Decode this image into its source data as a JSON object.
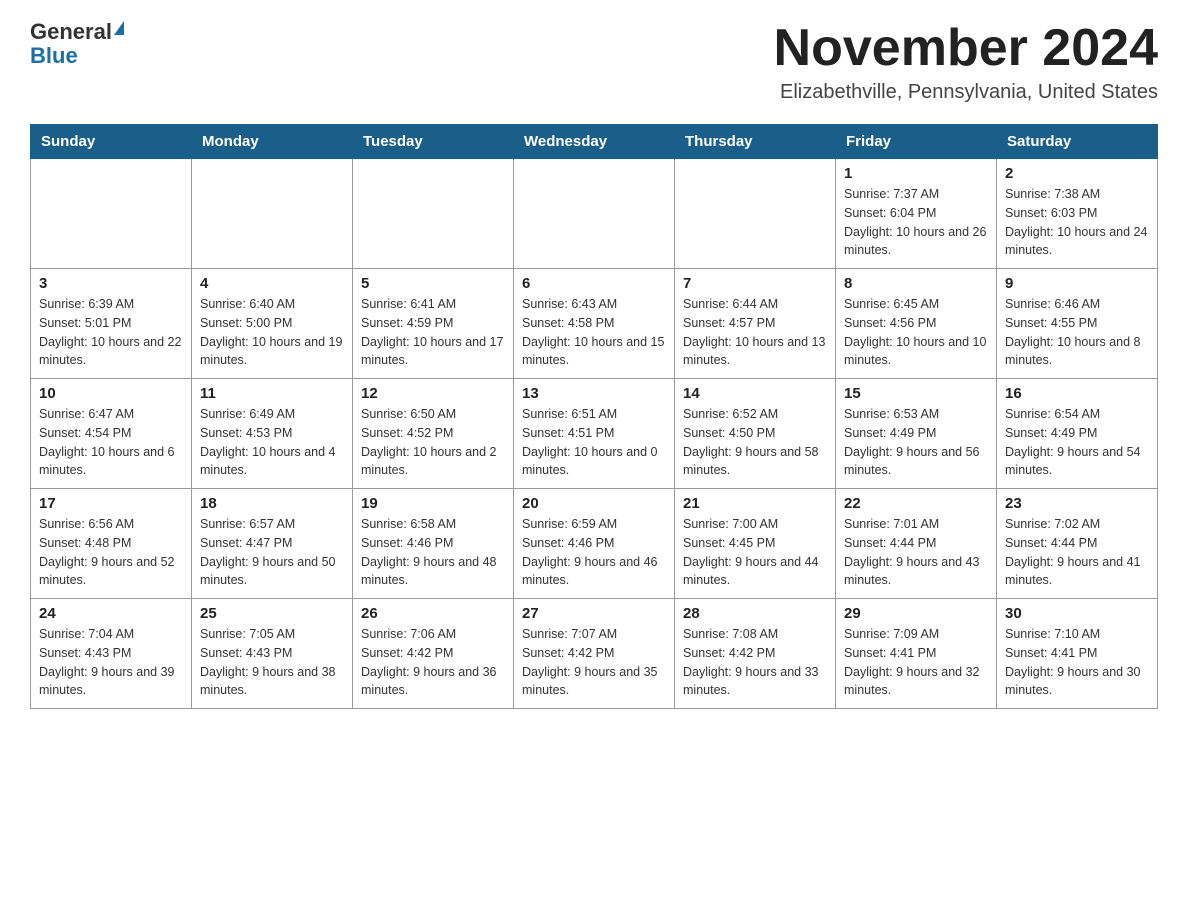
{
  "header": {
    "logo_line1": "General",
    "logo_line2": "Blue",
    "month": "November 2024",
    "location": "Elizabethville, Pennsylvania, United States"
  },
  "weekdays": [
    "Sunday",
    "Monday",
    "Tuesday",
    "Wednesday",
    "Thursday",
    "Friday",
    "Saturday"
  ],
  "weeks": [
    [
      {
        "day": "",
        "info": ""
      },
      {
        "day": "",
        "info": ""
      },
      {
        "day": "",
        "info": ""
      },
      {
        "day": "",
        "info": ""
      },
      {
        "day": "",
        "info": ""
      },
      {
        "day": "1",
        "info": "Sunrise: 7:37 AM\nSunset: 6:04 PM\nDaylight: 10 hours and 26 minutes."
      },
      {
        "day": "2",
        "info": "Sunrise: 7:38 AM\nSunset: 6:03 PM\nDaylight: 10 hours and 24 minutes."
      }
    ],
    [
      {
        "day": "3",
        "info": "Sunrise: 6:39 AM\nSunset: 5:01 PM\nDaylight: 10 hours and 22 minutes."
      },
      {
        "day": "4",
        "info": "Sunrise: 6:40 AM\nSunset: 5:00 PM\nDaylight: 10 hours and 19 minutes."
      },
      {
        "day": "5",
        "info": "Sunrise: 6:41 AM\nSunset: 4:59 PM\nDaylight: 10 hours and 17 minutes."
      },
      {
        "day": "6",
        "info": "Sunrise: 6:43 AM\nSunset: 4:58 PM\nDaylight: 10 hours and 15 minutes."
      },
      {
        "day": "7",
        "info": "Sunrise: 6:44 AM\nSunset: 4:57 PM\nDaylight: 10 hours and 13 minutes."
      },
      {
        "day": "8",
        "info": "Sunrise: 6:45 AM\nSunset: 4:56 PM\nDaylight: 10 hours and 10 minutes."
      },
      {
        "day": "9",
        "info": "Sunrise: 6:46 AM\nSunset: 4:55 PM\nDaylight: 10 hours and 8 minutes."
      }
    ],
    [
      {
        "day": "10",
        "info": "Sunrise: 6:47 AM\nSunset: 4:54 PM\nDaylight: 10 hours and 6 minutes."
      },
      {
        "day": "11",
        "info": "Sunrise: 6:49 AM\nSunset: 4:53 PM\nDaylight: 10 hours and 4 minutes."
      },
      {
        "day": "12",
        "info": "Sunrise: 6:50 AM\nSunset: 4:52 PM\nDaylight: 10 hours and 2 minutes."
      },
      {
        "day": "13",
        "info": "Sunrise: 6:51 AM\nSunset: 4:51 PM\nDaylight: 10 hours and 0 minutes."
      },
      {
        "day": "14",
        "info": "Sunrise: 6:52 AM\nSunset: 4:50 PM\nDaylight: 9 hours and 58 minutes."
      },
      {
        "day": "15",
        "info": "Sunrise: 6:53 AM\nSunset: 4:49 PM\nDaylight: 9 hours and 56 minutes."
      },
      {
        "day": "16",
        "info": "Sunrise: 6:54 AM\nSunset: 4:49 PM\nDaylight: 9 hours and 54 minutes."
      }
    ],
    [
      {
        "day": "17",
        "info": "Sunrise: 6:56 AM\nSunset: 4:48 PM\nDaylight: 9 hours and 52 minutes."
      },
      {
        "day": "18",
        "info": "Sunrise: 6:57 AM\nSunset: 4:47 PM\nDaylight: 9 hours and 50 minutes."
      },
      {
        "day": "19",
        "info": "Sunrise: 6:58 AM\nSunset: 4:46 PM\nDaylight: 9 hours and 48 minutes."
      },
      {
        "day": "20",
        "info": "Sunrise: 6:59 AM\nSunset: 4:46 PM\nDaylight: 9 hours and 46 minutes."
      },
      {
        "day": "21",
        "info": "Sunrise: 7:00 AM\nSunset: 4:45 PM\nDaylight: 9 hours and 44 minutes."
      },
      {
        "day": "22",
        "info": "Sunrise: 7:01 AM\nSunset: 4:44 PM\nDaylight: 9 hours and 43 minutes."
      },
      {
        "day": "23",
        "info": "Sunrise: 7:02 AM\nSunset: 4:44 PM\nDaylight: 9 hours and 41 minutes."
      }
    ],
    [
      {
        "day": "24",
        "info": "Sunrise: 7:04 AM\nSunset: 4:43 PM\nDaylight: 9 hours and 39 minutes."
      },
      {
        "day": "25",
        "info": "Sunrise: 7:05 AM\nSunset: 4:43 PM\nDaylight: 9 hours and 38 minutes."
      },
      {
        "day": "26",
        "info": "Sunrise: 7:06 AM\nSunset: 4:42 PM\nDaylight: 9 hours and 36 minutes."
      },
      {
        "day": "27",
        "info": "Sunrise: 7:07 AM\nSunset: 4:42 PM\nDaylight: 9 hours and 35 minutes."
      },
      {
        "day": "28",
        "info": "Sunrise: 7:08 AM\nSunset: 4:42 PM\nDaylight: 9 hours and 33 minutes."
      },
      {
        "day": "29",
        "info": "Sunrise: 7:09 AM\nSunset: 4:41 PM\nDaylight: 9 hours and 32 minutes."
      },
      {
        "day": "30",
        "info": "Sunrise: 7:10 AM\nSunset: 4:41 PM\nDaylight: 9 hours and 30 minutes."
      }
    ]
  ]
}
